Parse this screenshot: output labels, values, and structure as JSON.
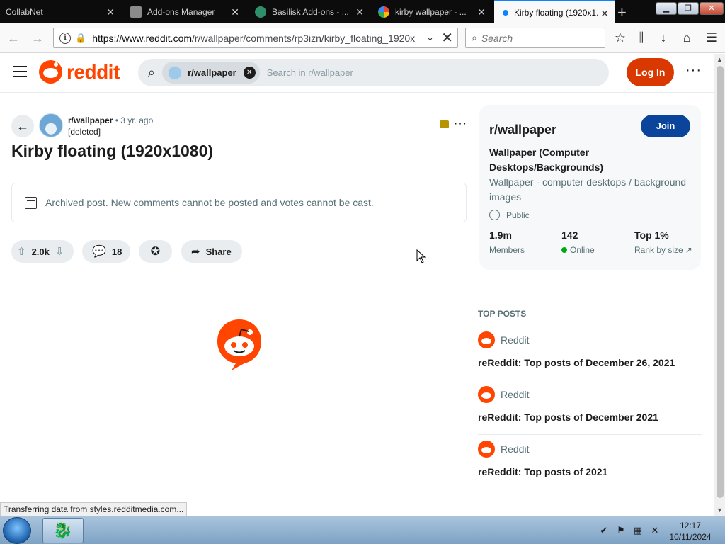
{
  "browser": {
    "tabs": [
      {
        "label": "CollabNet",
        "active": false
      },
      {
        "label": "Add-ons Manager",
        "active": false
      },
      {
        "label": "Basilisk Add-ons - ...",
        "active": false
      },
      {
        "label": "kirby wallpaper - ...",
        "active": false
      },
      {
        "label": "Kirby floating (1920x1...",
        "active": true
      }
    ],
    "url_host": "https://www.reddit.com",
    "url_rest": "/r/wallpaper/comments/rp3izn/kirby_floating_1920x",
    "search_placeholder": "Search",
    "status_text": "Transferring data from styles.redditmedia.com..."
  },
  "header": {
    "logo_text": "reddit",
    "search_chip": "r/wallpaper",
    "search_placeholder": "Search in r/wallpaper",
    "login_label": "Log In"
  },
  "post": {
    "subreddit": "r/wallpaper",
    "time": "3 yr. ago",
    "author": "[deleted]",
    "title": "Kirby floating (1920x1080)",
    "archived_notice": "Archived post. New comments cannot be posted and votes cannot be cast.",
    "score": "2.0k",
    "comments": "18",
    "share_label": "Share"
  },
  "sidebar": {
    "name": "r/wallpaper",
    "join_label": "Join",
    "title": "Wallpaper (Computer Desktops/Backgrounds)",
    "description": "Wallpaper - computer desktops / background images",
    "visibility": "Public",
    "stats": [
      {
        "value": "1.9m",
        "label": "Members"
      },
      {
        "value": "142",
        "label": "Online"
      },
      {
        "value": "Top 1%",
        "label": "Rank by size"
      }
    ]
  },
  "top_posts": {
    "heading": "TOP POSTS",
    "items": [
      {
        "source": "Reddit",
        "title": "reReddit: Top posts of December 26, 2021"
      },
      {
        "source": "Reddit",
        "title": "reReddit: Top posts of December 2021"
      },
      {
        "source": "Reddit",
        "title": "reReddit: Top posts of 2021"
      }
    ]
  },
  "taskbar": {
    "time": "12:17",
    "date": "10/11/2024"
  },
  "colors": {
    "reddit_orange": "#ff4500",
    "login_bg": "#d93900",
    "join_bg": "#0a449b",
    "online_green": "#01a816"
  }
}
